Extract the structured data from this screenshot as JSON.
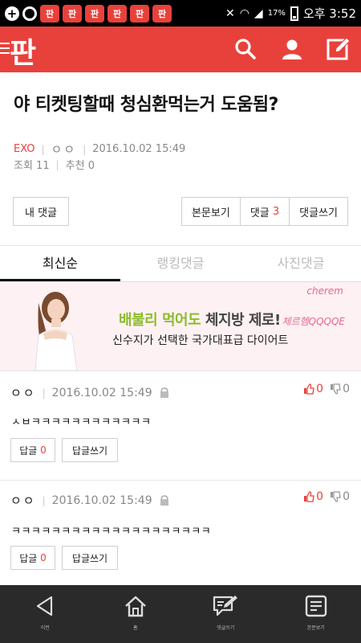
{
  "status_bar": {
    "pann_icon_text": "판",
    "battery": "17%",
    "time": "오후 3:52"
  },
  "header": {
    "logo": "판"
  },
  "post": {
    "title": "야 티켓팅할때 청심환먹는거 도움됨?",
    "category": "EXO",
    "author": "ㅇㅇ",
    "date": "2016.10.02 15:49",
    "views_label": "조회 11",
    "likes_label": "추천 0"
  },
  "actions": {
    "my_comments": "내 댓글",
    "view_post": "본문보기",
    "comments_label": "댓글",
    "comments_count": "3",
    "write_comment": "댓글쓰기"
  },
  "tabs": [
    {
      "label": "최신순",
      "active": true
    },
    {
      "label": "랭킹댓글",
      "active": false
    },
    {
      "label": "사진댓글",
      "active": false
    }
  ],
  "banner": {
    "brand": "cherem",
    "line1_a": "배불리 먹어도 ",
    "line1_b": "체지방 제로!",
    "script": "체르헴QQQQE",
    "line2": "신수지가 선택한 국가대표급 다이어트"
  },
  "comments": [
    {
      "author": "ㅇㅇ",
      "date": "2016.10.02 15:49",
      "up": "0",
      "down": "0",
      "text": "ㅅㅂㅋㅋㅋㅋㅋㅋㅋㅋㅋㅋㅋㅋ",
      "reply_label": "답글",
      "reply_count": "0",
      "write_reply": "답글쓰기"
    },
    {
      "author": "ㅇㅇ",
      "date": "2016.10.02 15:49",
      "up": "0",
      "down": "0",
      "text": "ㅋㅋㅋㅋㅋㅋㅋㅋㅋㅋㅋㅋㅋㅋㅋㅋㅋㅋㅋㅋ",
      "reply_label": "답글",
      "reply_count": "0",
      "write_reply": "답글쓰기"
    }
  ],
  "bottom_nav": [
    {
      "label": "이전",
      "icon": "back-icon"
    },
    {
      "label": "홈",
      "icon": "home-icon"
    },
    {
      "label": "댓글쓰기",
      "icon": "write-comment-icon"
    },
    {
      "label": "본문보기",
      "icon": "document-icon"
    }
  ],
  "colors": {
    "accent": "#e8413c",
    "bottom_nav_bg": "#2a2a2a"
  }
}
